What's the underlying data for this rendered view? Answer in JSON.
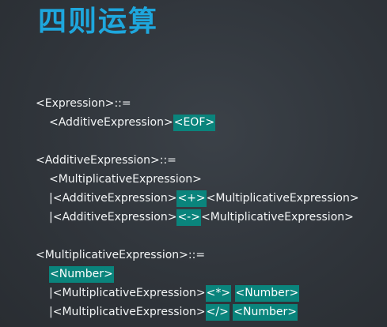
{
  "slide": {
    "title": "四则运算"
  },
  "grammar": {
    "expression": {
      "head": "<Expression>::=",
      "body_text": "<AdditiveExpression>",
      "body_token": "<EOF>"
    },
    "additive": {
      "head": "<AdditiveExpression>::=",
      "alt1": "<MultiplicativeExpression>",
      "alt2_pre": "|<AdditiveExpression>",
      "alt2_token": "<+>",
      "alt2_post": "<MultiplicativeExpression>",
      "alt3_pre": "|<AdditiveExpression>",
      "alt3_token": "<->",
      "alt3_post": "<MultiplicativeExpression>"
    },
    "multiplicative": {
      "head": "<MultiplicativeExpression>::=",
      "alt1_token": "<Number>",
      "alt2_pre": "|<MultiplicativeExpression>",
      "alt2_token": "<*>",
      "alt2_number": "<Number>",
      "alt3_pre": "|<MultiplicativeExpression>",
      "alt3_token": "</>",
      "alt3_number": "<Number>"
    }
  },
  "colors": {
    "title": "#1ea7dd",
    "token_highlight": "#0a847c",
    "text": "#f3f5f6",
    "background": "#30353b"
  }
}
